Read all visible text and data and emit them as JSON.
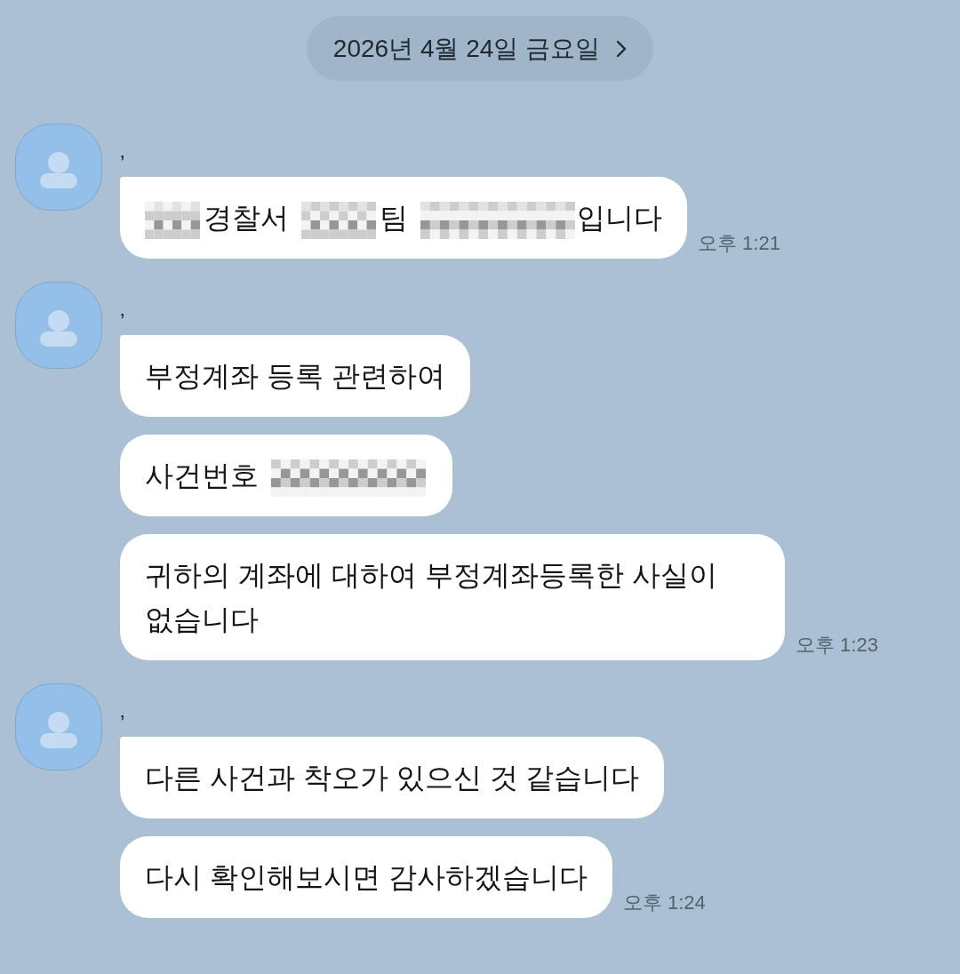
{
  "date_divider": {
    "label": "2026년 4월 24일 금요일"
  },
  "message_groups": [
    {
      "sender_name": "’",
      "time": "오후 1:21",
      "messages": [
        {
          "segments": [
            {
              "kind": "redacted_short"
            },
            {
              "kind": "text",
              "text": "경찰서"
            },
            {
              "kind": "redacted_medium"
            },
            {
              "kind": "text",
              "text": "팀"
            },
            {
              "kind": "redacted_long"
            },
            {
              "kind": "text",
              "text": "입니다"
            }
          ]
        }
      ]
    },
    {
      "sender_name": "’",
      "time": "오후 1:23",
      "messages": [
        {
          "segments": [
            {
              "kind": "text",
              "text": "부정계좌 등록 관련하여"
            }
          ]
        },
        {
          "segments": [
            {
              "kind": "text",
              "text": "사건번호"
            },
            {
              "kind": "redacted_long"
            }
          ]
        },
        {
          "segments": [
            {
              "kind": "text",
              "text": "귀하의 계좌에 대하여 부정계좌등록한 사실이 없습니다"
            }
          ]
        }
      ]
    },
    {
      "sender_name": "’",
      "time": "오후 1:24",
      "messages": [
        {
          "segments": [
            {
              "kind": "text",
              "text": "다른 사건과 착오가 있으신 것 같습니다"
            }
          ]
        },
        {
          "segments": [
            {
              "kind": "text",
              "text": "다시 확인해보시면 감사하겠습니다"
            }
          ]
        }
      ]
    }
  ]
}
